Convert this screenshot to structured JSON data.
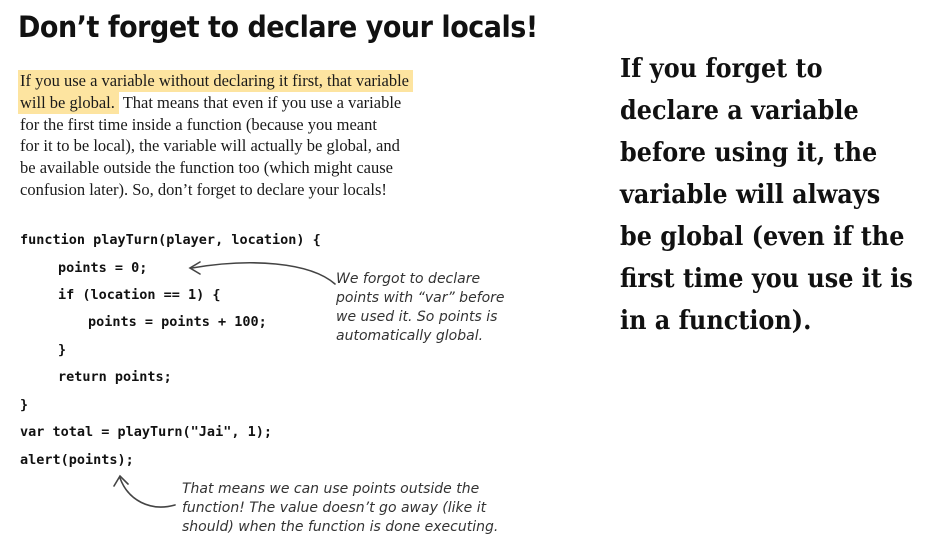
{
  "heading": "Don’t forget to declare your locals!",
  "paragraph": {
    "highlight_line1": "If you use a variable without declaring it first, that variable",
    "highlight_line2": "will be global.",
    "line2_rest": "That means that even if you use a variable",
    "line3": "for the first time inside a function (because you meant",
    "line4": "for it to be local), the variable will actually be global, and",
    "line5": "be available outside the function too (which might cause",
    "line6": "confusion later). So, don’t forget to declare your locals!"
  },
  "code": [
    "function playTurn(player, location) {",
    "points = 0;",
    "if (location == 1) {",
    "points = points + 100;",
    "}",
    "return points;",
    "}",
    "var total = playTurn(\"Jai\", 1);",
    "alert(points);"
  ],
  "annotation_points": [
    "We forgot to declare",
    "points with “var” before",
    "we used it. So points is",
    "automatically global."
  ],
  "annotation_alert": [
    "That means we can use points outside the",
    "function! The value doesn’t go away (like it",
    "should) when the function is done executing."
  ],
  "callout": [
    "If you forget to",
    "declare a variable",
    "before using it, the",
    "variable will always",
    "be global (even if the",
    "first time you use it is",
    "in a function)."
  ],
  "colors": {
    "highlight": "#fde4a0"
  }
}
